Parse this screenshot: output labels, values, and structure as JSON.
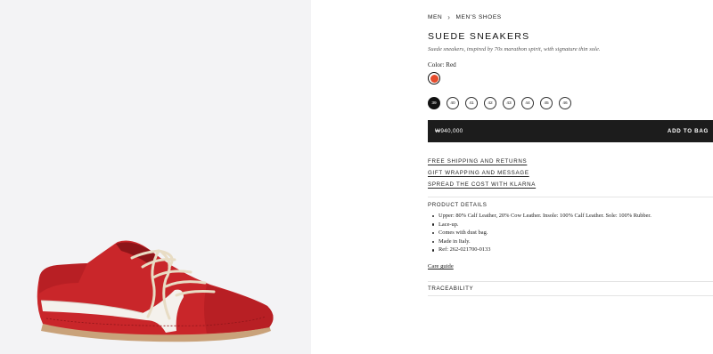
{
  "breadcrumb": {
    "items": [
      "MEN",
      "MEN'S SHOES"
    ],
    "separator": "›"
  },
  "product": {
    "title": "SUEDE SNEAKERS",
    "description": "Suede sneakers, inspired by 70s marathon spirit, with signature thin sole.",
    "color_label": "Color: Red",
    "swatch_color": "#e54b2c",
    "sizes": [
      "39",
      "40",
      "41",
      "42",
      "43",
      "44",
      "45",
      "46"
    ],
    "selected_size": "39",
    "price": "₩940,000",
    "add_to_bag": "ADD TO BAG"
  },
  "links": [
    "FREE SHIPPING AND RETURNS",
    "GIFT WRAPPING AND MESSAGE",
    "SPREAD THE COST WITH KLARNA"
  ],
  "product_details": {
    "heading": "PRODUCT DETAILS",
    "items": [
      "Upper: 80% Calf Leather, 20% Cow Leather. Insole: 100% Calf Leather. Sole: 100% Rubber.",
      "Lace-up.",
      "Comes with dust bag.",
      "Made in Italy.",
      "Ref: 262-021700-0133"
    ],
    "care_link": "Care guide"
  },
  "traceability": {
    "heading": "TRACEABILITY"
  },
  "colors": {
    "accent": "#1c1c1c",
    "shoe": "#c9262a",
    "stripe": "#f4f1ec",
    "sole": "#c9a27a"
  }
}
